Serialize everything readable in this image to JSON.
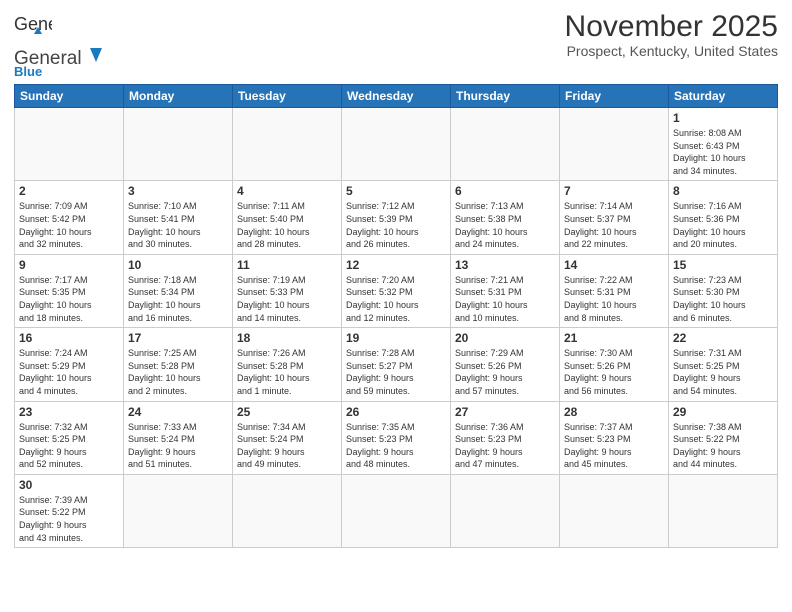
{
  "header": {
    "logo_general": "General",
    "logo_blue": "Blue",
    "title": "November 2025",
    "location": "Prospect, Kentucky, United States"
  },
  "days_of_week": [
    "Sunday",
    "Monday",
    "Tuesday",
    "Wednesday",
    "Thursday",
    "Friday",
    "Saturday"
  ],
  "weeks": [
    [
      {
        "day": "",
        "info": ""
      },
      {
        "day": "",
        "info": ""
      },
      {
        "day": "",
        "info": ""
      },
      {
        "day": "",
        "info": ""
      },
      {
        "day": "",
        "info": ""
      },
      {
        "day": "",
        "info": ""
      },
      {
        "day": "1",
        "info": "Sunrise: 8:08 AM\nSunset: 6:43 PM\nDaylight: 10 hours\nand 34 minutes."
      }
    ],
    [
      {
        "day": "2",
        "info": "Sunrise: 7:09 AM\nSunset: 5:42 PM\nDaylight: 10 hours\nand 32 minutes."
      },
      {
        "day": "3",
        "info": "Sunrise: 7:10 AM\nSunset: 5:41 PM\nDaylight: 10 hours\nand 30 minutes."
      },
      {
        "day": "4",
        "info": "Sunrise: 7:11 AM\nSunset: 5:40 PM\nDaylight: 10 hours\nand 28 minutes."
      },
      {
        "day": "5",
        "info": "Sunrise: 7:12 AM\nSunset: 5:39 PM\nDaylight: 10 hours\nand 26 minutes."
      },
      {
        "day": "6",
        "info": "Sunrise: 7:13 AM\nSunset: 5:38 PM\nDaylight: 10 hours\nand 24 minutes."
      },
      {
        "day": "7",
        "info": "Sunrise: 7:14 AM\nSunset: 5:37 PM\nDaylight: 10 hours\nand 22 minutes."
      },
      {
        "day": "8",
        "info": "Sunrise: 7:16 AM\nSunset: 5:36 PM\nDaylight: 10 hours\nand 20 minutes."
      }
    ],
    [
      {
        "day": "9",
        "info": "Sunrise: 7:17 AM\nSunset: 5:35 PM\nDaylight: 10 hours\nand 18 minutes."
      },
      {
        "day": "10",
        "info": "Sunrise: 7:18 AM\nSunset: 5:34 PM\nDaylight: 10 hours\nand 16 minutes."
      },
      {
        "day": "11",
        "info": "Sunrise: 7:19 AM\nSunset: 5:33 PM\nDaylight: 10 hours\nand 14 minutes."
      },
      {
        "day": "12",
        "info": "Sunrise: 7:20 AM\nSunset: 5:32 PM\nDaylight: 10 hours\nand 12 minutes."
      },
      {
        "day": "13",
        "info": "Sunrise: 7:21 AM\nSunset: 5:31 PM\nDaylight: 10 hours\nand 10 minutes."
      },
      {
        "day": "14",
        "info": "Sunrise: 7:22 AM\nSunset: 5:31 PM\nDaylight: 10 hours\nand 8 minutes."
      },
      {
        "day": "15",
        "info": "Sunrise: 7:23 AM\nSunset: 5:30 PM\nDaylight: 10 hours\nand 6 minutes."
      }
    ],
    [
      {
        "day": "16",
        "info": "Sunrise: 7:24 AM\nSunset: 5:29 PM\nDaylight: 10 hours\nand 4 minutes."
      },
      {
        "day": "17",
        "info": "Sunrise: 7:25 AM\nSunset: 5:28 PM\nDaylight: 10 hours\nand 2 minutes."
      },
      {
        "day": "18",
        "info": "Sunrise: 7:26 AM\nSunset: 5:28 PM\nDaylight: 10 hours\nand 1 minute."
      },
      {
        "day": "19",
        "info": "Sunrise: 7:28 AM\nSunset: 5:27 PM\nDaylight: 9 hours\nand 59 minutes."
      },
      {
        "day": "20",
        "info": "Sunrise: 7:29 AM\nSunset: 5:26 PM\nDaylight: 9 hours\nand 57 minutes."
      },
      {
        "day": "21",
        "info": "Sunrise: 7:30 AM\nSunset: 5:26 PM\nDaylight: 9 hours\nand 56 minutes."
      },
      {
        "day": "22",
        "info": "Sunrise: 7:31 AM\nSunset: 5:25 PM\nDaylight: 9 hours\nand 54 minutes."
      }
    ],
    [
      {
        "day": "23",
        "info": "Sunrise: 7:32 AM\nSunset: 5:25 PM\nDaylight: 9 hours\nand 52 minutes."
      },
      {
        "day": "24",
        "info": "Sunrise: 7:33 AM\nSunset: 5:24 PM\nDaylight: 9 hours\nand 51 minutes."
      },
      {
        "day": "25",
        "info": "Sunrise: 7:34 AM\nSunset: 5:24 PM\nDaylight: 9 hours\nand 49 minutes."
      },
      {
        "day": "26",
        "info": "Sunrise: 7:35 AM\nSunset: 5:23 PM\nDaylight: 9 hours\nand 48 minutes."
      },
      {
        "day": "27",
        "info": "Sunrise: 7:36 AM\nSunset: 5:23 PM\nDaylight: 9 hours\nand 47 minutes."
      },
      {
        "day": "28",
        "info": "Sunrise: 7:37 AM\nSunset: 5:23 PM\nDaylight: 9 hours\nand 45 minutes."
      },
      {
        "day": "29",
        "info": "Sunrise: 7:38 AM\nSunset: 5:22 PM\nDaylight: 9 hours\nand 44 minutes."
      }
    ],
    [
      {
        "day": "30",
        "info": "Sunrise: 7:39 AM\nSunset: 5:22 PM\nDaylight: 9 hours\nand 43 minutes."
      },
      {
        "day": "",
        "info": ""
      },
      {
        "day": "",
        "info": ""
      },
      {
        "day": "",
        "info": ""
      },
      {
        "day": "",
        "info": ""
      },
      {
        "day": "",
        "info": ""
      },
      {
        "day": "",
        "info": ""
      }
    ]
  ]
}
